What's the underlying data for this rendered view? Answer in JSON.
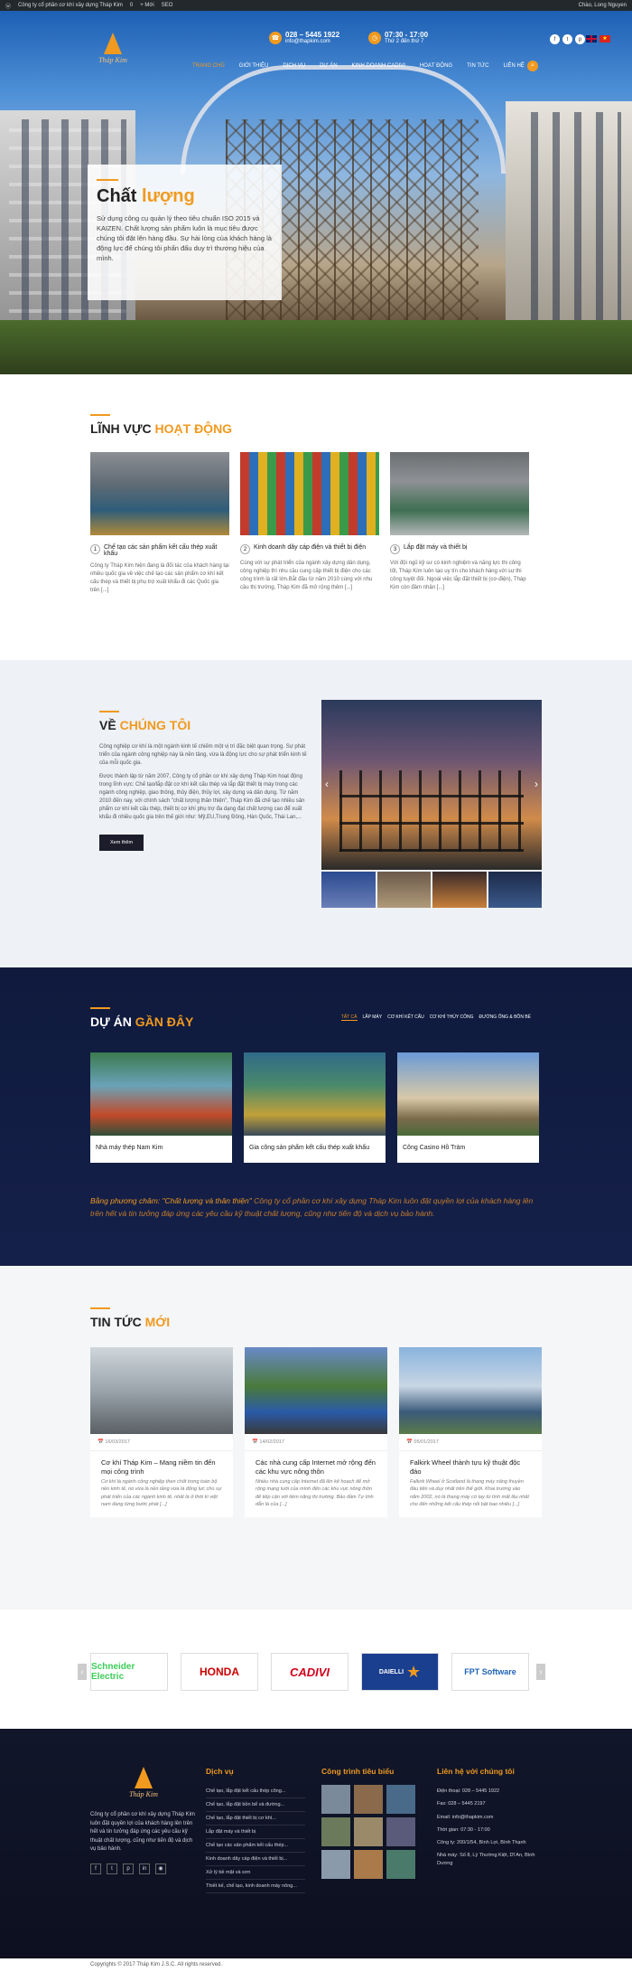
{
  "wp_bar": {
    "site": "Công ty cổ phần cơ khí xây dựng Tháp Kim",
    "comments": "0",
    "new": "+ Mới",
    "seo": "SEO",
    "greeting": "Chào, Long Nguyen"
  },
  "header": {
    "logo_text": "Tháp Kim",
    "phone": "028 – 5445 1922",
    "email": "info@thapkim.com",
    "hours": "07:30 - 17:00",
    "days": "Thứ 2 đến thứ 7",
    "nav": [
      "Trang chủ",
      "Giới thiệu",
      "Dịch vụ",
      "Dự án",
      "Kinh doanh cadivi",
      "Hoạt động",
      "Tin tức",
      "Liên hệ"
    ]
  },
  "hero": {
    "title_a": "Chất",
    "title_b": "lượng",
    "text": "Sử dụng công cụ quản lý theo tiêu chuẩn ISO 2015 và KAIZEN. Chất lượng sản phẩm luôn là mục tiêu được chúng tôi đặt lên hàng đầu. Sự hài lòng của khách hàng là động lực để chúng tôi phấn đấu duy trì thương hiệu của mình."
  },
  "activities": {
    "title_a": "Lĩnh vực",
    "title_b": "hoạt động",
    "cards": [
      {
        "num": "1",
        "title": "Chế tạo các sản phẩm kết cấu thép xuất khẩu",
        "text": "Công ty Tháp Kim hiện đang là đối tác của khách hàng tại nhiều quốc gia về việc chế tạo các sản phẩm cơ khí kết cấu thép và thiết bị phụ trợ xuất khẩu đi các Quốc gia trên [...]"
      },
      {
        "num": "2",
        "title": "Kinh doanh dây cáp điện và thiết bị điện",
        "text": "Cùng với sự phát triển của ngành xây dựng dân dụng, công nghiệp thì nhu cầu cung cấp thiết bị điện cho các công trình là rất lớn.Bắt đầu từ năm 2010 cùng với nhu cầu thị trường, Tháp Kim đã mở rộng thêm [...]"
      },
      {
        "num": "3",
        "title": "Lắp đặt máy và thiết bị",
        "text": "Với đội ngũ kỹ sư có kinh nghiệm và năng lực thi công tốt, Tháp Kim luôn tạo uy tín cho khách hàng với sự thi công tuyệt đối. Ngoài việc lắp đặt thiết bị (cơ-điện), Tháp Kim còn đảm nhận [...]"
      }
    ]
  },
  "about": {
    "title_a": "Về",
    "title_b": "chúng tôi",
    "p1": "Công nghiệp cơ khí là một ngành kinh tế chiếm một vị trí đặc biệt quan trọng. Sự phát triển của ngành công nghiệp này là nền tảng, vừa là động lực cho sự phát triển kinh tế của mỗi quốc gia.",
    "p2": "Được thành lập từ năm 2007, Công ty cổ phần cơ khí xây dựng Tháp Kim hoạt động trong lĩnh vực: Chế tạo/lắp đặt cơ khí kết cấu thép và lắp đặt thiết bị máy trong các ngành công nghiệp, giao thông, thủy điện, thủy lợi, xây dựng và dân dụng. Từ năm 2010 đến nay, với chính sách \"chất lượng thân thiện\", Tháp Kim đã chế tạo nhiều sản phẩm cơ khí kết cấu thép, thiết bị cơ khí phụ trợ đa dạng đạt chất lượng cao để xuất khẩu đi nhiều quốc gia trên thế giới như: Mỹ,EU,Trung Đông, Hàn Quốc, Thái Lan,...",
    "button": "Xem thêm"
  },
  "projects": {
    "title_a": "Dự án",
    "title_b": "gần đây",
    "filters": [
      "Tất cả",
      "Lắp máy",
      "Cơ khí kết cấu",
      "Cơ khí thủy công",
      "Đường ống & bồn bể"
    ],
    "cards": [
      {
        "title": "Nhà máy thép Nam Kim"
      },
      {
        "title": "Gia công sản phẩm kết cấu thép xuất khẩu"
      },
      {
        "title": "Công Casino Hồ Tràm"
      }
    ],
    "quote_a": "Bằng phương châm: \"Chất lượng và thân thiện\"",
    "quote_b": " Công ty cổ phần cơ khí xây dựng Tháp Kim luôn đặt quyền lợi của khách hàng lên trên hết và tin tưởng đáp ứng các yêu cầu kỹ thuật chất lượng, cũng như tiến độ và dịch vụ bảo hành."
  },
  "news": {
    "title_a": "Tin tức",
    "title_b": "mới",
    "cards": [
      {
        "date": "16/03/2017",
        "title": "Cơ khí Tháp Kim – Mang niềm tin đến mọi công trình",
        "text": "Cơ khí là ngành công nghiệp then chốt trong toàn bộ nền kinh tế, nó vừa là nền tảng vừa là động lực cho sự phát triển của các ngành kinh tế, nhất là ở thời kì việt nam đang từng bước phát [...]"
      },
      {
        "date": "14/02/2017",
        "title": "Các nhà cung cấp Internet mở rộng đến các khu vực nông thôn",
        "text": "Nhiều nhà cung cấp Internet đã lên kế hoạch để mở rộng mạng lưới của mình đến các khu vực nông thôn để tiếp cận với tiềm năng thị trường. Bảo đảm Tự tính dẫn là của [...]"
      },
      {
        "date": "05/01/2017",
        "title": "Falkirk Wheel thành tựu kỹ thuật độc đáo",
        "text": "Falkirk Wheel ở Scotland là thang máy nâng thuyền đầu tiên và duy nhất trên thế giới. Khai trương vào năm 2002, nó là thang máy có tay từ tính mất lâu nhất cho đến những kết cấu thép nổi bật bao nhiêu [...]"
      }
    ]
  },
  "partners": [
    {
      "name": "Schneider Electric"
    },
    {
      "name": "HONDA"
    },
    {
      "name": "CADIVI"
    },
    {
      "name": "DAIELLI"
    },
    {
      "name": "FPT Software"
    }
  ],
  "footer": {
    "about": "Công ty cổ phần cơ khí xây dựng Tháp Kim luôn đặt quyền lợi của khách hàng lên trên hết và tin tưởng đáp ứng các yêu cầu kỹ thuật chất lượng, cũng như tiến độ và dịch vụ bảo hành.",
    "services_title": "Dịch vụ",
    "services": [
      "Chế tạo, lắp đặt kết cấu thép công...",
      "Chế tạo, lắp đặt bồn bể và đường...",
      "Chế tạo, lắp đặt thiết bị cơ khí...",
      "Lắp đặt máy và thiết bị",
      "Chế tạo các sản phẩm kết cấu thép...",
      "Kinh doanh dây cáp điện và thiết bị...",
      "Xử lý bề mặt và sơn",
      "Thiết kế, chế tạo, kinh doanh máy nông..."
    ],
    "projects_title": "Công trình tiêu biểu",
    "contact_title": "Liên hệ với chúng tôi",
    "contact": [
      "Điện thoại: 028 – 5445 1922",
      "Fax: 028 – 5445 2197",
      "Email: info@thapkim.com",
      "Thời gian: 07:30 - 17:00",
      "Công ty: 200/1/54, Bình Lợi, Bình Thạnh",
      "Nhà máy: Số 8, Lý Thường Kiệt, Dĩ An, Bình Dương"
    ]
  },
  "copyright": "Copyrights © 2017 Tháp Kim J.S.C. All rights reserved."
}
